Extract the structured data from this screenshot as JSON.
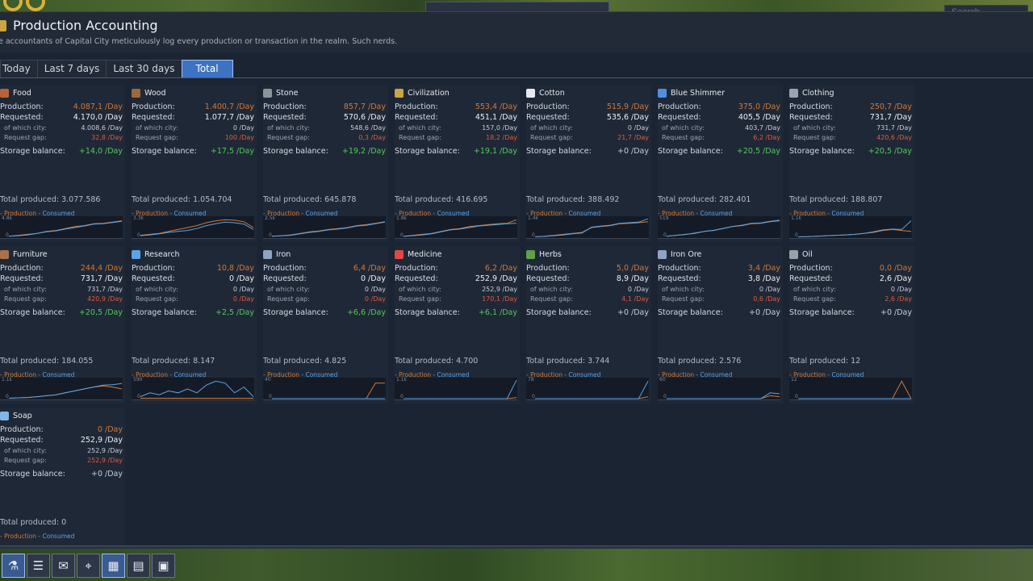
{
  "search": {
    "placeholder": "Search..."
  },
  "window": {
    "title": "Production Accounting",
    "subtitle": "e accountants of Capital City meticulously log every production or transaction in the realm. Such nerds."
  },
  "tabs": [
    "Today",
    "Last 7 days",
    "Last 30 days",
    "Total"
  ],
  "active_tab": "Total",
  "labels": {
    "production": "Production:",
    "requested": "Requested:",
    "of_which_city": "of which city:",
    "request_gap": "Request gap:",
    "storage_balance": "Storage balance:",
    "legend_production": "- Production",
    "legend_consumed": "- Consumed"
  },
  "colors": {
    "accent": "#3d73c2",
    "production": "#d07a36",
    "consumed": "#5aa4e8",
    "positive": "#52c95c",
    "negative": "#e05a3c"
  },
  "resources": [
    {
      "name": "Food",
      "icon": "meat-icon",
      "icon_color": "#b5643a",
      "production": "4.087,1 /Day",
      "requested": "4.170,0 /Day",
      "city": "4.008,6 /Day",
      "gap": "32,8 /Day",
      "balance": "+14,0 /Day",
      "balance_positive": true,
      "total": "Total produced: 3.077.586",
      "ymax": "4.8k",
      "ymin": "0"
    },
    {
      "name": "Wood",
      "icon": "log-icon",
      "icon_color": "#9a6a3a",
      "production": "1.400,7 /Day",
      "requested": "1.077,7 /Day",
      "city": "0 /Day",
      "gap": "100 /Day",
      "balance": "+17,5 /Day",
      "balance_positive": true,
      "total": "Total produced: 1.054.704",
      "ymax": "3.3k",
      "ymin": "0"
    },
    {
      "name": "Stone",
      "icon": "stone-icon",
      "icon_color": "#8d939c",
      "production": "857,7 /Day",
      "requested": "570,6 /Day",
      "city": "548,6 /Day",
      "gap": "0,3 /Day",
      "balance": "+19,2 /Day",
      "balance_positive": true,
      "total": "Total produced: 645.878",
      "ymax": "2.5k",
      "ymin": "0"
    },
    {
      "name": "Civilization",
      "icon": "laurel-icon",
      "icon_color": "#c9a640",
      "production": "553,4 /Day",
      "requested": "451,1 /Day",
      "city": "157,0 /Day",
      "gap": "18,2 /Day",
      "balance": "+19,1 /Day",
      "balance_positive": true,
      "total": "Total produced: 416.695",
      "ymax": "1.8k",
      "ymin": "0"
    },
    {
      "name": "Cotton",
      "icon": "cotton-icon",
      "icon_color": "#e8e8ee",
      "production": "515,9 /Day",
      "requested": "535,6 /Day",
      "city": "0 /Day",
      "gap": "21,7 /Day",
      "balance": "+0 /Day",
      "balance_positive": false,
      "total": "Total produced: 388.492",
      "ymax": "1.4k",
      "ymin": "0"
    },
    {
      "name": "Blue Shimmer",
      "icon": "crystal-icon",
      "icon_color": "#4f8fe0",
      "production": "375,0 /Day",
      "requested": "405,5 /Day",
      "city": "403,7 /Day",
      "gap": "6,2 /Day",
      "balance": "+20,5 /Day",
      "balance_positive": true,
      "total": "Total produced: 282.401",
      "ymax": "519",
      "ymin": "0"
    },
    {
      "name": "Clothing",
      "icon": "shirt-icon",
      "icon_color": "#9aa4b4",
      "production": "250,7 /Day",
      "requested": "731,7 /Day",
      "city": "731,7 /Day",
      "gap": "420,6 /Day",
      "balance": "+20,5 /Day",
      "balance_positive": true,
      "total": "Total produced: 188.807",
      "ymax": "1.1k",
      "ymin": "0"
    },
    {
      "name": "Furniture",
      "icon": "chair-icon",
      "icon_color": "#a8724a",
      "production": "244,4 /Day",
      "requested": "731,7 /Day",
      "city": "731,7 /Day",
      "gap": "420,9 /Day",
      "balance": "+20,5 /Day",
      "balance_positive": true,
      "total": "Total produced: 184.055",
      "ymax": "1.1k",
      "ymin": "0"
    },
    {
      "name": "Research",
      "icon": "flask-icon",
      "icon_color": "#5aa4e8",
      "production": "10,8 /Day",
      "requested": "0 /Day",
      "city": "0 /Day",
      "gap": "0 /Day",
      "balance": "+2,5 /Day",
      "balance_positive": true,
      "total": "Total produced: 8.147",
      "ymax": "590",
      "ymin": "0"
    },
    {
      "name": "Iron",
      "icon": "iron-icon",
      "icon_color": "#8fa4c0",
      "production": "6,4 /Day",
      "requested": "0 /Day",
      "city": "0 /Day",
      "gap": "0 /Day",
      "balance": "+6,6 /Day",
      "balance_positive": true,
      "total": "Total produced: 4.825",
      "ymax": "40",
      "ymin": "0"
    },
    {
      "name": "Medicine",
      "icon": "medkit-icon",
      "icon_color": "#e04848",
      "production": "6,2 /Day",
      "requested": "252,9 /Day",
      "city": "252,9 /Day",
      "gap": "170,1 /Day",
      "balance": "+6,1 /Day",
      "balance_positive": true,
      "total": "Total produced: 4.700",
      "ymax": "1.1k",
      "ymin": "0"
    },
    {
      "name": "Herbs",
      "icon": "herb-icon",
      "icon_color": "#5ea04a",
      "production": "5,0 /Day",
      "requested": "8,9 /Day",
      "city": "0 /Day",
      "gap": "4,1 /Day",
      "balance": "+0 /Day",
      "balance_positive": false,
      "total": "Total produced: 3.744",
      "ymax": "78",
      "ymin": "0"
    },
    {
      "name": "Iron Ore",
      "icon": "ore-icon",
      "icon_color": "#8fa4c0",
      "production": "3,4 /Day",
      "requested": "3,8 /Day",
      "city": "0 /Day",
      "gap": "0,6 /Day",
      "balance": "+0 /Day",
      "balance_positive": false,
      "total": "Total produced: 2.576",
      "ymax": "60",
      "ymin": "0"
    },
    {
      "name": "Oil",
      "icon": "barrel-icon",
      "icon_color": "#9aa0aa",
      "production": "0,0 /Day",
      "requested": "2,6 /Day",
      "city": "0 /Day",
      "gap": "2,6 /Day",
      "balance": "+0 /Day",
      "balance_positive": false,
      "total": "Total produced: 12",
      "ymax": "12",
      "ymin": "0"
    },
    {
      "name": "Soap",
      "icon": "soap-icon",
      "icon_color": "#7fb8e8",
      "production": "0 /Day",
      "requested": "252,9 /Day",
      "city": "252,9 /Day",
      "gap": "252,9 /Day",
      "balance": "+0 /Day",
      "balance_positive": false,
      "total": "Total produced: 0",
      "ymax": "",
      "ymin": ""
    }
  ],
  "chart_data": [
    {
      "type": "line",
      "name": "Food",
      "series": [
        {
          "name": "Production",
          "color": "#d07a36",
          "values": [
            0.05,
            0.1,
            0.15,
            0.2,
            0.3,
            0.35,
            0.45,
            0.55,
            0.6,
            0.7,
            0.72,
            0.78,
            0.85
          ]
        },
        {
          "name": "Consumed",
          "color": "#5aa4e8",
          "values": [
            0.05,
            0.08,
            0.12,
            0.2,
            0.28,
            0.33,
            0.42,
            0.5,
            0.58,
            0.68,
            0.7,
            0.76,
            0.82
          ]
        }
      ]
    },
    {
      "type": "line",
      "name": "Wood",
      "series": [
        {
          "name": "Production",
          "color": "#d07a36",
          "values": [
            0.1,
            0.15,
            0.2,
            0.3,
            0.4,
            0.5,
            0.6,
            0.75,
            0.85,
            0.9,
            0.88,
            0.8,
            0.5
          ]
        },
        {
          "name": "Consumed",
          "color": "#5aa4e8",
          "values": [
            0.08,
            0.12,
            0.18,
            0.25,
            0.3,
            0.35,
            0.45,
            0.6,
            0.7,
            0.78,
            0.75,
            0.68,
            0.4
          ]
        }
      ]
    },
    {
      "type": "line",
      "name": "Stone",
      "series": [
        {
          "name": "Production",
          "color": "#d07a36",
          "values": [
            0.05,
            0.08,
            0.12,
            0.2,
            0.28,
            0.32,
            0.4,
            0.45,
            0.5,
            0.6,
            0.65,
            0.72,
            0.8
          ]
        },
        {
          "name": "Consumed",
          "color": "#5aa4e8",
          "values": [
            0.05,
            0.07,
            0.1,
            0.18,
            0.25,
            0.3,
            0.38,
            0.42,
            0.48,
            0.58,
            0.62,
            0.7,
            0.78
          ]
        }
      ]
    },
    {
      "type": "line",
      "name": "Civilization",
      "series": [
        {
          "name": "Production",
          "color": "#d07a36",
          "values": [
            0.05,
            0.1,
            0.15,
            0.2,
            0.3,
            0.4,
            0.45,
            0.55,
            0.6,
            0.65,
            0.7,
            0.72,
            0.9
          ]
        },
        {
          "name": "Consumed",
          "color": "#5aa4e8",
          "values": [
            0.04,
            0.08,
            0.12,
            0.18,
            0.28,
            0.38,
            0.42,
            0.5,
            0.58,
            0.62,
            0.66,
            0.7,
            0.72
          ]
        }
      ]
    },
    {
      "type": "line",
      "name": "Cotton",
      "series": [
        {
          "name": "Production",
          "color": "#d07a36",
          "values": [
            0.02,
            0.05,
            0.1,
            0.15,
            0.2,
            0.25,
            0.5,
            0.55,
            0.6,
            0.7,
            0.72,
            0.75,
            0.8
          ]
        },
        {
          "name": "Consumed",
          "color": "#5aa4e8",
          "values": [
            0.02,
            0.04,
            0.08,
            0.12,
            0.18,
            0.22,
            0.52,
            0.58,
            0.62,
            0.72,
            0.75,
            0.78,
            0.95
          ]
        }
      ]
    },
    {
      "type": "line",
      "name": "Blue Shimmer",
      "series": [
        {
          "name": "Production",
          "color": "#d07a36",
          "values": [
            0.05,
            0.1,
            0.15,
            0.2,
            0.3,
            0.35,
            0.45,
            0.55,
            0.6,
            0.7,
            0.72,
            0.8,
            0.85
          ]
        },
        {
          "name": "Consumed",
          "color": "#5aa4e8",
          "values": [
            0.05,
            0.1,
            0.14,
            0.22,
            0.3,
            0.36,
            0.46,
            0.56,
            0.62,
            0.72,
            0.74,
            0.82,
            0.88
          ]
        }
      ]
    },
    {
      "type": "line",
      "name": "Clothing",
      "series": [
        {
          "name": "Production",
          "color": "#d07a36",
          "values": [
            0.02,
            0.03,
            0.05,
            0.08,
            0.1,
            0.12,
            0.15,
            0.2,
            0.25,
            0.35,
            0.4,
            0.35,
            0.3
          ]
        },
        {
          "name": "Consumed",
          "color": "#5aa4e8",
          "values": [
            0.02,
            0.03,
            0.05,
            0.08,
            0.1,
            0.12,
            0.15,
            0.2,
            0.28,
            0.38,
            0.42,
            0.4,
            0.85
          ]
        }
      ]
    },
    {
      "type": "line",
      "name": "Furniture",
      "series": [
        {
          "name": "Production",
          "color": "#d07a36",
          "values": [
            0.02,
            0.04,
            0.06,
            0.1,
            0.15,
            0.2,
            0.3,
            0.4,
            0.5,
            0.6,
            0.65,
            0.6,
            0.5
          ]
        },
        {
          "name": "Consumed",
          "color": "#5aa4e8",
          "values": [
            0.02,
            0.04,
            0.06,
            0.1,
            0.15,
            0.2,
            0.3,
            0.4,
            0.5,
            0.6,
            0.7,
            0.72,
            0.78
          ]
        }
      ]
    },
    {
      "type": "line",
      "name": "Research",
      "series": [
        {
          "name": "Production",
          "color": "#d07a36",
          "values": [
            0.02,
            0.02,
            0.02,
            0.02,
            0.02,
            0.02,
            0.02,
            0.02,
            0.02,
            0.02,
            0.02,
            0.02,
            0.02
          ]
        },
        {
          "name": "Consumed",
          "color": "#5aa4e8",
          "values": [
            0.1,
            0.3,
            0.2,
            0.4,
            0.3,
            0.5,
            0.3,
            0.7,
            0.9,
            0.8,
            0.3,
            0.6,
            0.1
          ]
        }
      ]
    },
    {
      "type": "line",
      "name": "Iron",
      "series": [
        {
          "name": "Production",
          "color": "#d07a36",
          "values": [
            0,
            0,
            0,
            0,
            0,
            0,
            0,
            0,
            0,
            0,
            0,
            0.8,
            0.8
          ]
        },
        {
          "name": "Consumed",
          "color": "#5aa4e8",
          "values": [
            0,
            0,
            0,
            0,
            0,
            0,
            0,
            0,
            0,
            0,
            0,
            0,
            0
          ]
        }
      ]
    },
    {
      "type": "line",
      "name": "Medicine",
      "series": [
        {
          "name": "Production",
          "color": "#d07a36",
          "values": [
            0,
            0,
            0,
            0,
            0,
            0,
            0,
            0,
            0,
            0,
            0,
            0,
            0.05
          ]
        },
        {
          "name": "Consumed",
          "color": "#5aa4e8",
          "values": [
            0,
            0,
            0,
            0,
            0,
            0,
            0,
            0,
            0,
            0,
            0,
            0,
            0.95
          ]
        }
      ]
    },
    {
      "type": "line",
      "name": "Herbs",
      "series": [
        {
          "name": "Production",
          "color": "#d07a36",
          "values": [
            0,
            0,
            0,
            0,
            0,
            0,
            0,
            0,
            0,
            0,
            0,
            0,
            0.1
          ]
        },
        {
          "name": "Consumed",
          "color": "#5aa4e8",
          "values": [
            0,
            0,
            0,
            0,
            0,
            0,
            0,
            0,
            0,
            0,
            0,
            0,
            0.9
          ]
        }
      ]
    },
    {
      "type": "line",
      "name": "Iron Ore",
      "series": [
        {
          "name": "Production",
          "color": "#d07a36",
          "values": [
            0,
            0,
            0,
            0,
            0,
            0,
            0,
            0,
            0,
            0,
            0,
            0.15,
            0.1
          ]
        },
        {
          "name": "Consumed",
          "color": "#5aa4e8",
          "values": [
            0,
            0,
            0,
            0,
            0,
            0,
            0,
            0,
            0,
            0,
            0,
            0.3,
            0.25
          ]
        }
      ]
    },
    {
      "type": "line",
      "name": "Oil",
      "series": [
        {
          "name": "Production",
          "color": "#d07a36",
          "values": [
            0,
            0,
            0,
            0,
            0,
            0,
            0,
            0,
            0,
            0,
            0,
            0.9,
            0
          ]
        },
        {
          "name": "Consumed",
          "color": "#5aa4e8",
          "values": [
            0,
            0,
            0,
            0,
            0,
            0,
            0,
            0,
            0,
            0,
            0,
            0,
            0
          ]
        }
      ]
    }
  ],
  "toolbar": [
    {
      "icon": "potion-icon",
      "glyph": "⚗",
      "active": true
    },
    {
      "icon": "ledger-icon",
      "glyph": "☰",
      "active": false
    },
    {
      "icon": "mail-icon",
      "glyph": "✉",
      "active": false
    },
    {
      "icon": "map-icon",
      "glyph": "⌖",
      "active": false
    },
    {
      "icon": "accounting-icon",
      "glyph": "▦",
      "active": true
    },
    {
      "icon": "table-icon",
      "glyph": "▤",
      "active": false
    },
    {
      "icon": "calendar-icon",
      "glyph": "▣",
      "active": false
    }
  ]
}
